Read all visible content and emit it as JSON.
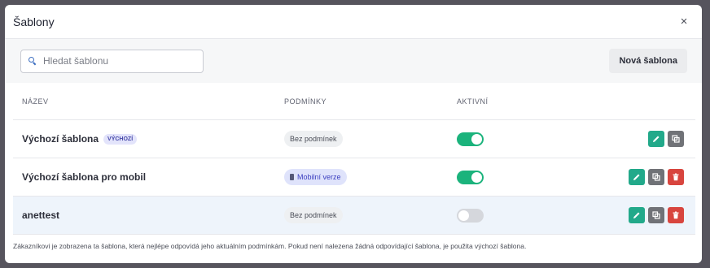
{
  "modal": {
    "title": "Šablony",
    "close_label": "×"
  },
  "toolbar": {
    "search_placeholder": "Hledat šablonu",
    "new_button_label": "Nová šablona"
  },
  "table": {
    "columns": [
      "NÁZEV",
      "PODMÍNKY",
      "AKTIVNÍ"
    ],
    "rows": [
      {
        "name": "Výchozí šablona",
        "badge": "VÝCHOZÍ",
        "condition": "Bez podmínek",
        "active": true
      },
      {
        "name": "Výchozí šablona pro mobil",
        "condition": "Mobilní verze",
        "active": true
      },
      {
        "name": "anettest",
        "condition": "Bez podmínek",
        "active": false
      }
    ]
  },
  "footer": {
    "note": "Zákazníkovi je zobrazena ta šablona, která nejlépe odpovídá jeho aktuálním podmínkám. Pokud není nalezena žádná odpovídající šablona, je použita výchozí šablona."
  },
  "colors": {
    "toggle_on": "#1bb37c",
    "edit": "#22a98a",
    "copy": "#707277",
    "delete": "#d8453e",
    "default_badge": "#e3e4fb",
    "mobile_badge": "#dfe3fb"
  },
  "icons": {
    "search": "search-icon",
    "edit": "pencil-icon",
    "copy": "copy-icon",
    "delete": "trash-icon",
    "mobile": "phone-icon"
  }
}
